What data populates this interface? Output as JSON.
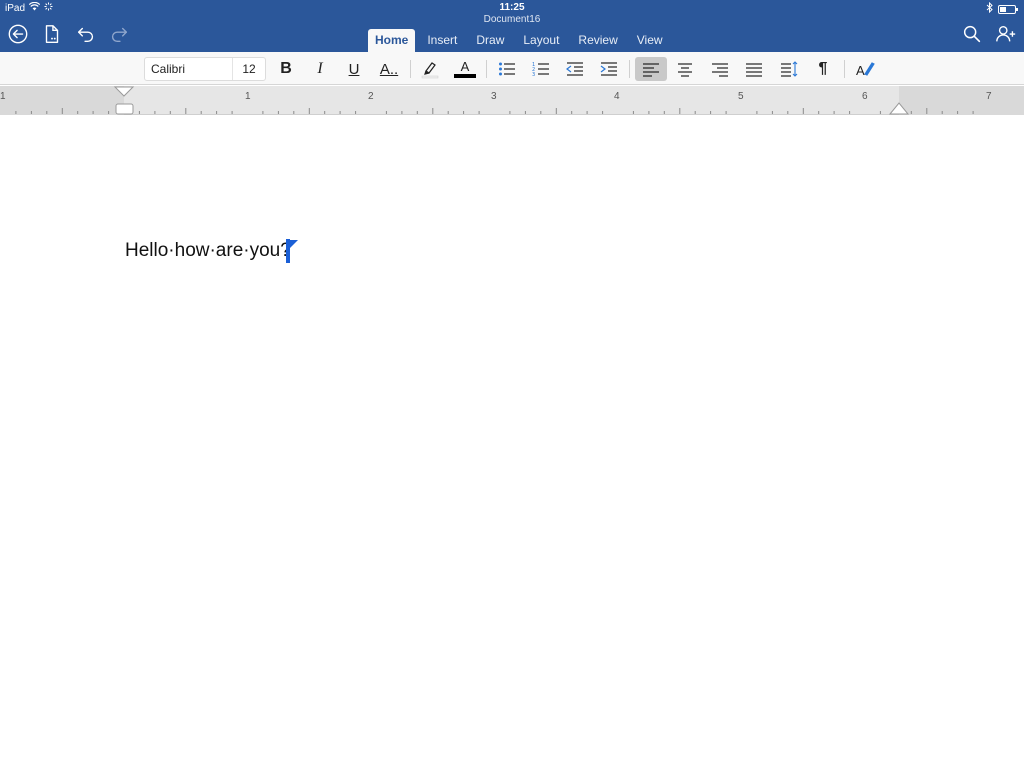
{
  "status": {
    "device": "iPad",
    "time": "11:25"
  },
  "document": {
    "title": "Document16",
    "text": "Hello·how·are·you?"
  },
  "tabs": [
    "Home",
    "Insert",
    "Draw",
    "Layout",
    "Review",
    "View"
  ],
  "ribbon": {
    "font_name": "Calibri",
    "font_size": "12",
    "bold_label": "B",
    "italic_label": "I",
    "underline_label": "U",
    "text_effects_label": "A..",
    "font_color_label": "A",
    "paragraph_mark": "¶"
  },
  "ruler": {
    "left_label": "1",
    "labels": [
      "1",
      "2",
      "3",
      "4",
      "5",
      "6",
      "7"
    ]
  },
  "colors": {
    "header_blue": "#2b579a",
    "caret_blue": "#1a5fd6",
    "font_color": "#000000"
  }
}
